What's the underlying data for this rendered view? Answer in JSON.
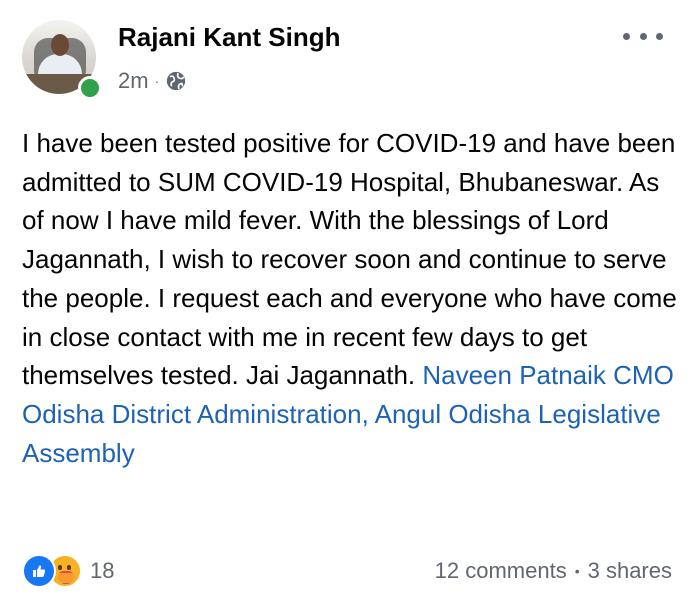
{
  "post": {
    "author": "Rajani Kant Singh",
    "time": "2m",
    "separator": "·",
    "privacy_icon": "globe-icon",
    "body": "I have been tested positive for COVID-19 and have been admitted to SUM COVID-19 Hospital, Bhubaneswar. As of now I have mild fever. With the blessings of Lord Jagannath, I wish to recover soon and continue to serve the people. I request each and everyone who have come in close contact with me in recent few days to get themselves tested. Jai Jagannath.",
    "tags": [
      "Naveen Patnaik",
      "CMO Odisha",
      "District Administration, Angul",
      "Odisha Legislative Assembly"
    ]
  },
  "footer": {
    "reaction_icons": [
      "like-icon",
      "care-icon"
    ],
    "reaction_count": "18",
    "comments": "12 comments",
    "dot": "•",
    "shares": "3 shares"
  },
  "colors": {
    "link": "#1d62b4",
    "online": "#31a24c",
    "like": "#1877f2",
    "muted": "#606770"
  }
}
